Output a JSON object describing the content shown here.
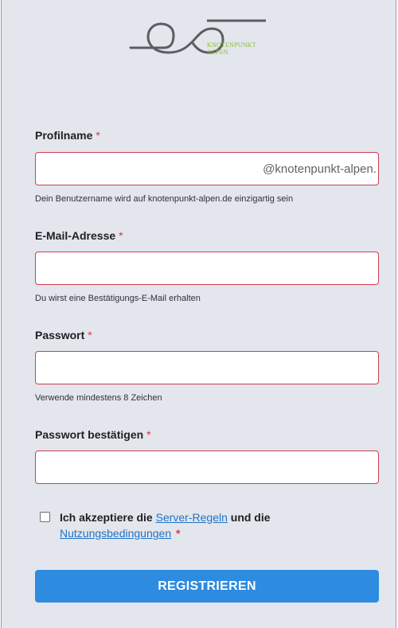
{
  "brand": {
    "line1": "KNOTENPUNKT",
    "line2": "ALPEN",
    "colors": {
      "accent_green": "#8dbb3a",
      "logo_gray": "#5b5d62"
    }
  },
  "form": {
    "profilname": {
      "label": "Profilname",
      "required_mark": "*",
      "value": "",
      "suffix": "@knotenpunkt-alpen.",
      "help": "Dein Benutzername wird auf knotenpunkt-alpen.de einzigartig sein"
    },
    "email": {
      "label": "E-Mail-Adresse",
      "required_mark": "*",
      "value": "",
      "help": "Du wirst eine Bestätigungs-E-Mail erhalten"
    },
    "password": {
      "label": "Passwort",
      "required_mark": "*",
      "value": "",
      "help": "Verwende mindestens 8 Zeichen"
    },
    "password_confirm": {
      "label": "Passwort bestätigen",
      "required_mark": "*",
      "value": ""
    },
    "terms": {
      "checked": false,
      "text_before": "Ich akzeptiere die",
      "link1": "Server-Regeln",
      "text_middle": "und die",
      "link2": "Nutzungsbedingungen",
      "required_mark": "*"
    },
    "submit_label": "REGISTRIEREN"
  },
  "colors": {
    "background": "#e3e6ec",
    "input_border_error": "#cf3d55",
    "required": "#d23b4a",
    "link": "#1f73c7",
    "button": "#2d8be0"
  }
}
